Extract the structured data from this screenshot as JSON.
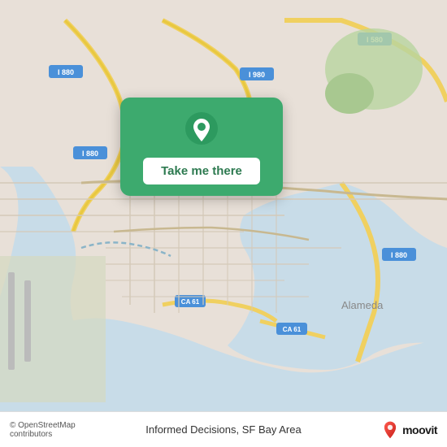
{
  "map": {
    "background_color": "#e8e0d8",
    "attribution": "© OpenStreetMap contributors"
  },
  "popup": {
    "button_label": "Take me there",
    "pin_icon": "location-pin-icon"
  },
  "bottom_bar": {
    "copyright": "© OpenStreetMap contributors",
    "location_name": "Informed Decisions, SF Bay Area",
    "logo_name": "moovit",
    "logo_text": "moovit"
  }
}
